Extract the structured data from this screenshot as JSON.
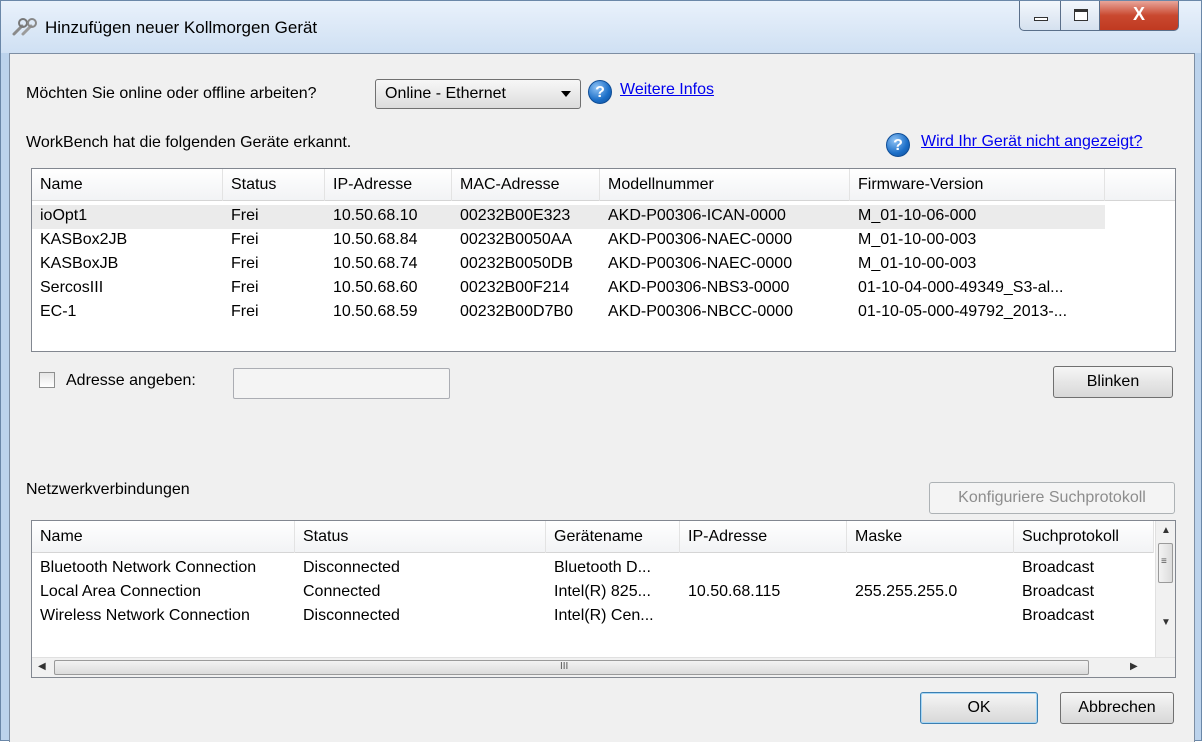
{
  "window": {
    "title": "Hinzufügen neuer Kollmorgen Gerät",
    "min_icon": "minimize-icon",
    "max_icon": "maximize-icon",
    "close_glyph": "X"
  },
  "mode": {
    "question": "Möchten Sie online oder offline arbeiten?",
    "selected": "Online - Ethernet",
    "help_glyph": "?",
    "more_info_link": "Weitere Infos"
  },
  "devices": {
    "label": "WorkBench hat die folgenden Geräte erkannt.",
    "not_shown_link": "Wird Ihr Gerät nicht angezeigt?",
    "columns": [
      "Name",
      "Status",
      "IP-Adresse",
      "MAC-Adresse",
      "Modellnummer",
      "Firmware-Version"
    ],
    "rows": [
      [
        "ioOpt1",
        "Frei",
        "10.50.68.10",
        "00232B00E323",
        "AKD-P00306-ICAN-0000",
        "M_01-10-06-000"
      ],
      [
        "KASBox2JB",
        "Frei",
        "10.50.68.84",
        "00232B0050AA",
        "AKD-P00306-NAEC-0000",
        "M_01-10-00-003"
      ],
      [
        "KASBoxJB",
        "Frei",
        "10.50.68.74",
        "00232B0050DB",
        "AKD-P00306-NAEC-0000",
        "M_01-10-00-003"
      ],
      [
        "SercosIII",
        "Frei",
        "10.50.68.60",
        "00232B00F214",
        "AKD-P00306-NBS3-0000",
        "01-10-04-000-49349_S3-al..."
      ],
      [
        "EC-1",
        "Frei",
        "10.50.68.59",
        "00232B00D7B0",
        "AKD-P00306-NBCC-0000",
        "01-10-05-000-49792_2013-..."
      ]
    ]
  },
  "address": {
    "checkbox_label": "Adresse angeben:",
    "value": ""
  },
  "blink_button": "Blinken",
  "network": {
    "label": "Netzwerkverbindungen",
    "config_button": "Konfiguriere Suchprotokoll",
    "columns": [
      "Name",
      "Status",
      "Gerätename",
      "IP-Adresse",
      "Maske",
      "Suchprotokoll"
    ],
    "rows": [
      [
        "Bluetooth Network Connection",
        "Disconnected",
        "Bluetooth D...",
        "",
        "",
        "Broadcast"
      ],
      [
        "Local Area Connection",
        "Connected",
        "Intel(R) 825...",
        "10.50.68.115",
        "255.255.255.0",
        "Broadcast"
      ],
      [
        "Wireless Network Connection",
        "Disconnected",
        "Intel(R) Cen...",
        "",
        "",
        "Broadcast"
      ]
    ],
    "scroll_grip": "III",
    "vscroll_grip": "≡"
  },
  "ok_button": "OK",
  "cancel_button": "Abbrechen"
}
